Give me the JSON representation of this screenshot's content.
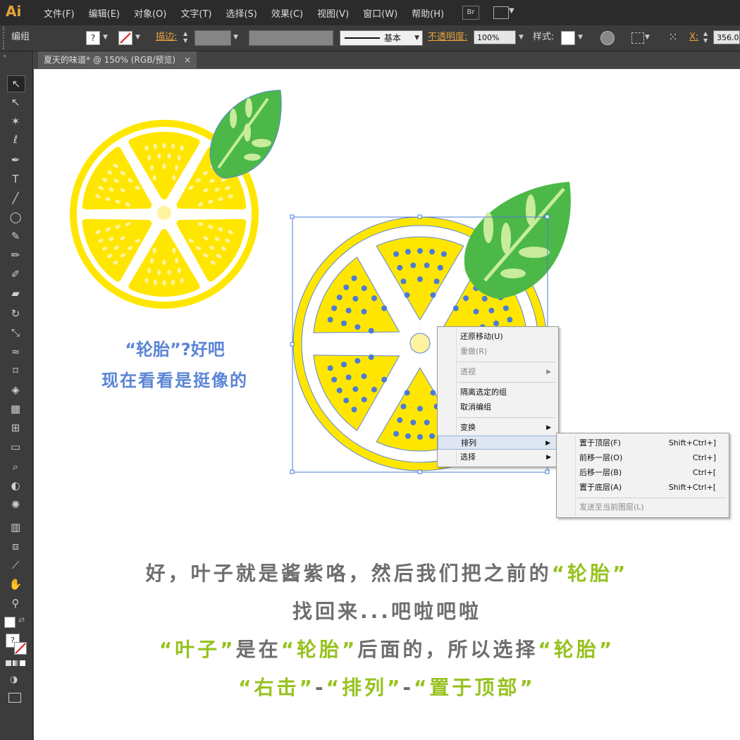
{
  "app": {
    "logo": "Ai"
  },
  "menubar": {
    "items": [
      "文件(F)",
      "编辑(E)",
      "对象(O)",
      "文字(T)",
      "选择(S)",
      "效果(C)",
      "视图(V)",
      "窗口(W)",
      "帮助(H)"
    ],
    "bridge_label": "Br"
  },
  "control_bar": {
    "selection_label": "编组",
    "stroke_label": "描边:",
    "stroke_style": "基本",
    "opacity_label": "不透明度:",
    "opacity_value": "100%",
    "style_label": "样式:",
    "x_label": "X:",
    "x_value": "356.0"
  },
  "document_tab": {
    "title": "夏天的味道* @ 150% (RGB/预览)",
    "close": "×"
  },
  "toolbar": {
    "tools": [
      {
        "name": "selection-tool-icon",
        "glyph": "↖"
      },
      {
        "name": "direct-selection-tool-icon",
        "glyph": "↖"
      },
      {
        "name": "magic-wand-tool-icon",
        "glyph": "✶"
      },
      {
        "name": "lasso-tool-icon",
        "glyph": "ℓ"
      },
      {
        "name": "pen-tool-icon",
        "glyph": "✒"
      },
      {
        "name": "type-tool-icon",
        "glyph": "T"
      },
      {
        "name": "line-tool-icon",
        "glyph": "╱"
      },
      {
        "name": "ellipse-tool-icon",
        "glyph": "◯"
      },
      {
        "name": "paintbrush-tool-icon",
        "glyph": "✎"
      },
      {
        "name": "pencil-tool-icon",
        "glyph": "✏"
      },
      {
        "name": "blob-brush-tool-icon",
        "glyph": "✐"
      },
      {
        "name": "eraser-tool-icon",
        "glyph": "▰"
      },
      {
        "name": "rotate-tool-icon",
        "glyph": "↻"
      },
      {
        "name": "scale-tool-icon",
        "glyph": "⤡"
      },
      {
        "name": "warp-tool-icon",
        "glyph": "≈"
      },
      {
        "name": "free-transform-tool-icon",
        "glyph": "⌑"
      },
      {
        "name": "shape-builder-tool-icon",
        "glyph": "◈"
      },
      {
        "name": "perspective-grid-tool-icon",
        "glyph": "▦"
      },
      {
        "name": "mesh-tool-icon",
        "glyph": "⊞"
      },
      {
        "name": "gradient-tool-icon",
        "glyph": "▭"
      },
      {
        "name": "eyedropper-tool-icon",
        "glyph": "⌕"
      },
      {
        "name": "blend-tool-icon",
        "glyph": "◐"
      },
      {
        "name": "symbol-sprayer-tool-icon",
        "glyph": "✺"
      },
      {
        "name": "column-graph-tool-icon",
        "glyph": "▥"
      },
      {
        "name": "artboard-tool-icon",
        "glyph": "⧈"
      },
      {
        "name": "slice-tool-icon",
        "glyph": "⟋"
      },
      {
        "name": "hand-tool-icon",
        "glyph": "✋"
      },
      {
        "name": "zoom-tool-icon",
        "glyph": "⚲"
      }
    ]
  },
  "colors": {
    "lemon_yellow": "#ffe600",
    "lemon_pale": "#fff3a0",
    "leaf_green": "#4cb848",
    "leaf_light": "#c8ec9c",
    "selection_blue": "#4a7bd8",
    "caption_blue": "#5a84d6",
    "caption_gray": "#6e6e6e",
    "caption_green": "#97c21f"
  },
  "canvas": {
    "caption_left_line1": "“轮胎”?好吧",
    "caption_left_line2": "现在看看是挺像的",
    "caption_bottom_line1": [
      "好，叶子就是酱紫咯，然后我们把之前的",
      "“轮胎”"
    ],
    "caption_bottom_line2": "找回来...吧啦吧啦",
    "caption_bottom_line3": [
      "“叶子”",
      "是在",
      "“轮胎”",
      "后面的，所以选择",
      "“轮胎”"
    ],
    "caption_bottom_line4": [
      "“右击”",
      "-",
      "“排列”",
      "-",
      "“置于顶部”"
    ]
  },
  "context_menu": {
    "items": [
      {
        "label": "还原移动(U)",
        "disabled": false
      },
      {
        "label": "重做(R)",
        "disabled": true
      },
      {
        "label": "透视",
        "disabled": true,
        "submenu": true
      },
      {
        "label": "隔离选定的组",
        "disabled": false
      },
      {
        "label": "取消编组",
        "disabled": false
      },
      {
        "label": "变换",
        "disabled": false,
        "submenu": true
      },
      {
        "label": "排列",
        "disabled": false,
        "submenu": true,
        "highlighted": true
      },
      {
        "label": "选择",
        "disabled": false,
        "submenu": true
      }
    ]
  },
  "arrange_submenu": {
    "items": [
      {
        "label": "置于顶层(F)",
        "shortcut": "Shift+Ctrl+]"
      },
      {
        "label": "前移一层(O)",
        "shortcut": "Ctrl+]"
      },
      {
        "label": "后移一层(B)",
        "shortcut": "Ctrl+["
      },
      {
        "label": "置于底层(A)",
        "shortcut": "Shift+Ctrl+["
      },
      {
        "label": "发送至当前图层(L)",
        "shortcut": "",
        "disabled": true
      }
    ]
  }
}
